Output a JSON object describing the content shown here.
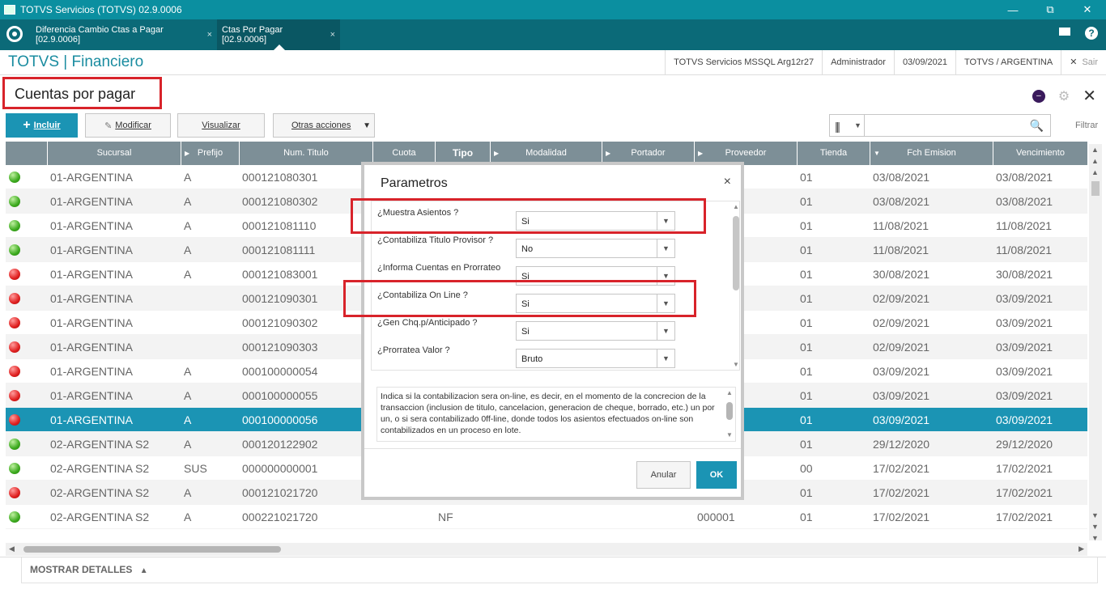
{
  "window": {
    "title": "TOTVS Servicios (TOTVS) 02.9.0006",
    "minimize": "—",
    "restore": "⧉",
    "close": "✕"
  },
  "tabs": [
    {
      "label": "Diferencia Cambio Ctas a Pagar [02.9.0006]",
      "close": "×"
    },
    {
      "label": "Ctas Por Pagar [02.9.0006]",
      "close": "×"
    }
  ],
  "header": {
    "brand": "TOTVS | Financiero",
    "server": "TOTVS Servicios MSSQL Arg12r27",
    "user": "Administrador",
    "date": "03/09/2021",
    "company": "TOTVS / ARGENTINA",
    "exit": "Sair",
    "help": "?"
  },
  "page": {
    "title": "Cuentas por pagar"
  },
  "toolbar": {
    "incluir": "Incluir",
    "modificar": "Modificar",
    "visualizar": "Visualizar",
    "otras": "Otras acciones",
    "filtrar": "Filtrar",
    "search_placeholder": ""
  },
  "grid": {
    "columns": [
      "Sucursal",
      "Prefijo",
      "Num. Titulo",
      "Cuota",
      "Tipo",
      "Modalidad",
      "Portador",
      "Proveedor",
      "Tienda",
      "Fch Emision",
      "Vencimiento"
    ],
    "rows": [
      {
        "status": "green",
        "sucursal": "01-ARGENTINA",
        "prefijo": "A",
        "num": "000121080301",
        "tipo": "",
        "proveedor": "",
        "tienda": "01",
        "emision": "03/08/2021",
        "venc": "03/08/2021"
      },
      {
        "status": "green",
        "sucursal": "01-ARGENTINA",
        "prefijo": "A",
        "num": "000121080302",
        "tipo": "",
        "proveedor": "",
        "tienda": "01",
        "emision": "03/08/2021",
        "venc": "03/08/2021"
      },
      {
        "status": "green",
        "sucursal": "01-ARGENTINA",
        "prefijo": "A",
        "num": "000121081110",
        "tipo": "",
        "proveedor": "",
        "tienda": "01",
        "emision": "11/08/2021",
        "venc": "11/08/2021"
      },
      {
        "status": "green",
        "sucursal": "01-ARGENTINA",
        "prefijo": "A",
        "num": "000121081111",
        "tipo": "",
        "proveedor": "",
        "tienda": "01",
        "emision": "11/08/2021",
        "venc": "11/08/2021"
      },
      {
        "status": "red",
        "sucursal": "01-ARGENTINA",
        "prefijo": "A",
        "num": "000121083001",
        "tipo": "",
        "proveedor": "",
        "tienda": "01",
        "emision": "30/08/2021",
        "venc": "30/08/2021"
      },
      {
        "status": "red",
        "sucursal": "01-ARGENTINA",
        "prefijo": "",
        "num": "000121090301",
        "tipo": "",
        "proveedor": "",
        "tienda": "01",
        "emision": "02/09/2021",
        "venc": "03/09/2021"
      },
      {
        "status": "red",
        "sucursal": "01-ARGENTINA",
        "prefijo": "",
        "num": "000121090302",
        "tipo": "",
        "proveedor": "",
        "tienda": "01",
        "emision": "02/09/2021",
        "venc": "03/09/2021"
      },
      {
        "status": "red",
        "sucursal": "01-ARGENTINA",
        "prefijo": "",
        "num": "000121090303",
        "tipo": "",
        "proveedor": "",
        "tienda": "01",
        "emision": "02/09/2021",
        "venc": "03/09/2021"
      },
      {
        "status": "red",
        "sucursal": "01-ARGENTINA",
        "prefijo": "A",
        "num": "000100000054",
        "tipo": "",
        "proveedor": "",
        "tienda": "01",
        "emision": "03/09/2021",
        "venc": "03/09/2021"
      },
      {
        "status": "red",
        "sucursal": "01-ARGENTINA",
        "prefijo": "A",
        "num": "000100000055",
        "tipo": "",
        "proveedor": "",
        "tienda": "01",
        "emision": "03/09/2021",
        "venc": "03/09/2021"
      },
      {
        "status": "red",
        "sucursal": "01-ARGENTINA",
        "prefijo": "A",
        "num": "000100000056",
        "tipo": "",
        "proveedor": "",
        "tienda": "01",
        "emision": "03/09/2021",
        "venc": "03/09/2021",
        "selected": true
      },
      {
        "status": "green",
        "sucursal": "02-ARGENTINA S2",
        "prefijo": "A",
        "num": "000120122902",
        "tipo": "",
        "proveedor": "",
        "tienda": "01",
        "emision": "29/12/2020",
        "venc": "29/12/2020"
      },
      {
        "status": "green",
        "sucursal": "02-ARGENTINA S2",
        "prefijo": "SUS",
        "num": "000000000001",
        "tipo": "",
        "proveedor": "",
        "tienda": "00",
        "emision": "17/02/2021",
        "venc": "17/02/2021"
      },
      {
        "status": "red",
        "sucursal": "02-ARGENTINA S2",
        "prefijo": "A",
        "num": "000121021720",
        "tipo": "",
        "proveedor": "",
        "tienda": "01",
        "emision": "17/02/2021",
        "venc": "17/02/2021"
      },
      {
        "status": "green",
        "sucursal": "02-ARGENTINA S2",
        "prefijo": "A",
        "num": "000221021720",
        "tipo": "NF",
        "proveedor": "000001",
        "tienda": "01",
        "emision": "17/02/2021",
        "venc": "17/02/2021"
      }
    ]
  },
  "details": {
    "label": "MOSTRAR DETALLES",
    "arrow": "▲"
  },
  "modal": {
    "title": "Parametros",
    "close": "×",
    "params": [
      {
        "label": "¿Muestra Asientos ?",
        "value": "Si"
      },
      {
        "label": "¿Contabiliza Titulo Provisor ?",
        "value": "No"
      },
      {
        "label": "¿Informa Cuentas en Prorrateo",
        "value": "Si"
      },
      {
        "label": "¿Contabiliza On Line ?",
        "value": "Si"
      },
      {
        "label": "¿Gen Chq.p/Anticipado ?",
        "value": "Si"
      },
      {
        "label": "¿Prorratea Valor ?",
        "value": "Bruto"
      }
    ],
    "description": "Indica si la contabilizacion sera on-line, es decir, en el momento de la concrecion de la transaccion (inclusion de titulo, cancelacion, generacion de cheque, borrado, etc.) un por un, o si sera contabilizado 0ff-line, donde todos los asientos efectuados on-line son contabilizados en un proceso en lote.",
    "cancel": "Anular",
    "ok": "OK"
  },
  "colors": {
    "titlebar": "#0b8fa0",
    "tabbar": "#0b6a78",
    "accent": "#1b94b4",
    "highlight": "#d8232a",
    "grid_header": "#7d8f97"
  }
}
